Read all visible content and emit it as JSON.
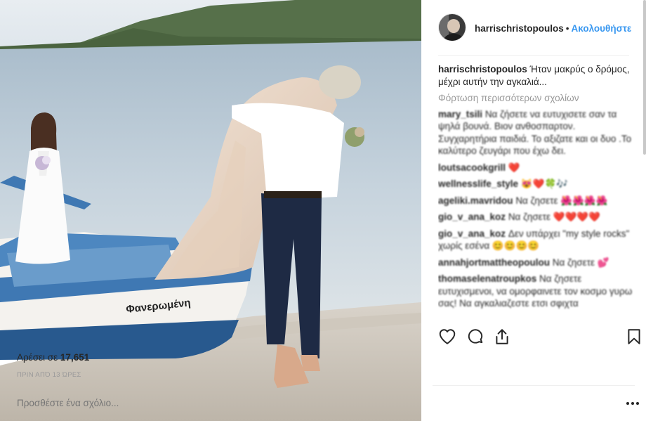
{
  "post": {
    "username": "harrischristopoulos",
    "separator": "•",
    "follow_label": "Ακολουθήστε",
    "boat_name": "Φανερωμένη"
  },
  "caption": {
    "username": "harrischristopoulos",
    "text": "Ήταν μακρύς ο δρόμος, μέχρι αυτήν την αγκαλιά..."
  },
  "load_more_label": "Φόρτωση περισσότερων σχολίων",
  "comments": [
    {
      "user": "mary_tsili",
      "text": "Να ζήσετε να ευτυχισετε σαν τα ψηλά βουνά. Βιον ανθοσπαρτον. Συγχαρητήρια παιδιά. Το αξιζατε και οι δυο .Το καλύτερο ζευγάρι που έχω δει."
    },
    {
      "user": "loutsacookgrill",
      "text": "❤️"
    },
    {
      "user": "wellnesslife_style",
      "text": "😻❤️🍀🎶"
    },
    {
      "user": "ageliki.mavridou",
      "text": "Να ζησετε 🌺🌺🌺🌺"
    },
    {
      "user": "gio_v_ana_koz",
      "text": "Να ζησετε ❤️❤️❤️❤️"
    },
    {
      "user": "gio_v_ana_koz",
      "text": "Δεν υπάρχει \"my style rocks\" χωρίς εσένα 😊😊😊😊"
    },
    {
      "user": "annahjortmattheopoulou",
      "text": "Να ζησετε 💕"
    },
    {
      "user": "thomaselenatroupkos",
      "text": "Να ζησετε ευτυχισμενοι, να ομορφαινετε τον κοσμο γυρω σας! Να αγκαλιαζεστε ετσι σφιχτα"
    }
  ],
  "actions": {
    "like_icon": "heart-icon",
    "comment_icon": "comment-icon",
    "share_icon": "share-icon",
    "save_icon": "bookmark-icon"
  },
  "likes": {
    "label": "Αρέσει σε",
    "count": "17,651"
  },
  "timestamp": "ΠΡΙΝ ΑΠΌ 13 ΏΡΕΣ",
  "comment_input": {
    "placeholder": "Προσθέστε ένα σχόλιο..."
  },
  "colors": {
    "link": "#3897f0",
    "text": "#262626",
    "muted": "#999999",
    "like_heart": "#ed4956"
  }
}
